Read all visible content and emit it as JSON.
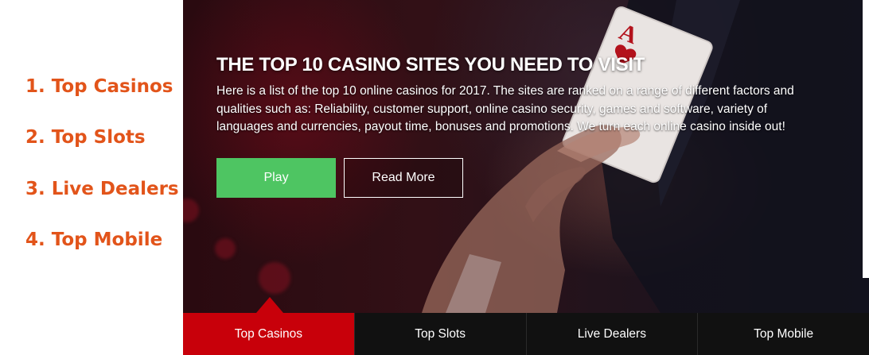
{
  "sidebar": {
    "items": [
      {
        "label": "1. Top Casinos"
      },
      {
        "label": "2. Top Slots"
      },
      {
        "label": "3. Live Dealers"
      },
      {
        "label": "4. Top Mobile"
      }
    ]
  },
  "hero": {
    "title": "THE TOP 10 CASINO SITES YOU NEED TO VISIT",
    "description": "Here is a list of the top 10 online casinos for 2017. The sites are ranked on a range of different factors and qualities such as: Reliability, customer support, online casino security, games and software, variety of languages and currencies, payout time, bonuses and promotions. We turn each online casino inside out!",
    "play_label": "Play",
    "read_more_label": "Read More",
    "card_rank": "A"
  },
  "tabs": [
    {
      "label": "Top Casinos",
      "active": true
    },
    {
      "label": "Top Slots",
      "active": false
    },
    {
      "label": "Live Dealers",
      "active": false
    },
    {
      "label": "Top Mobile",
      "active": false
    }
  ],
  "colors": {
    "accent_orange": "#e2541a",
    "active_tab_red": "#c8000a",
    "play_green": "#4ec562",
    "tab_bar": "#111111"
  }
}
